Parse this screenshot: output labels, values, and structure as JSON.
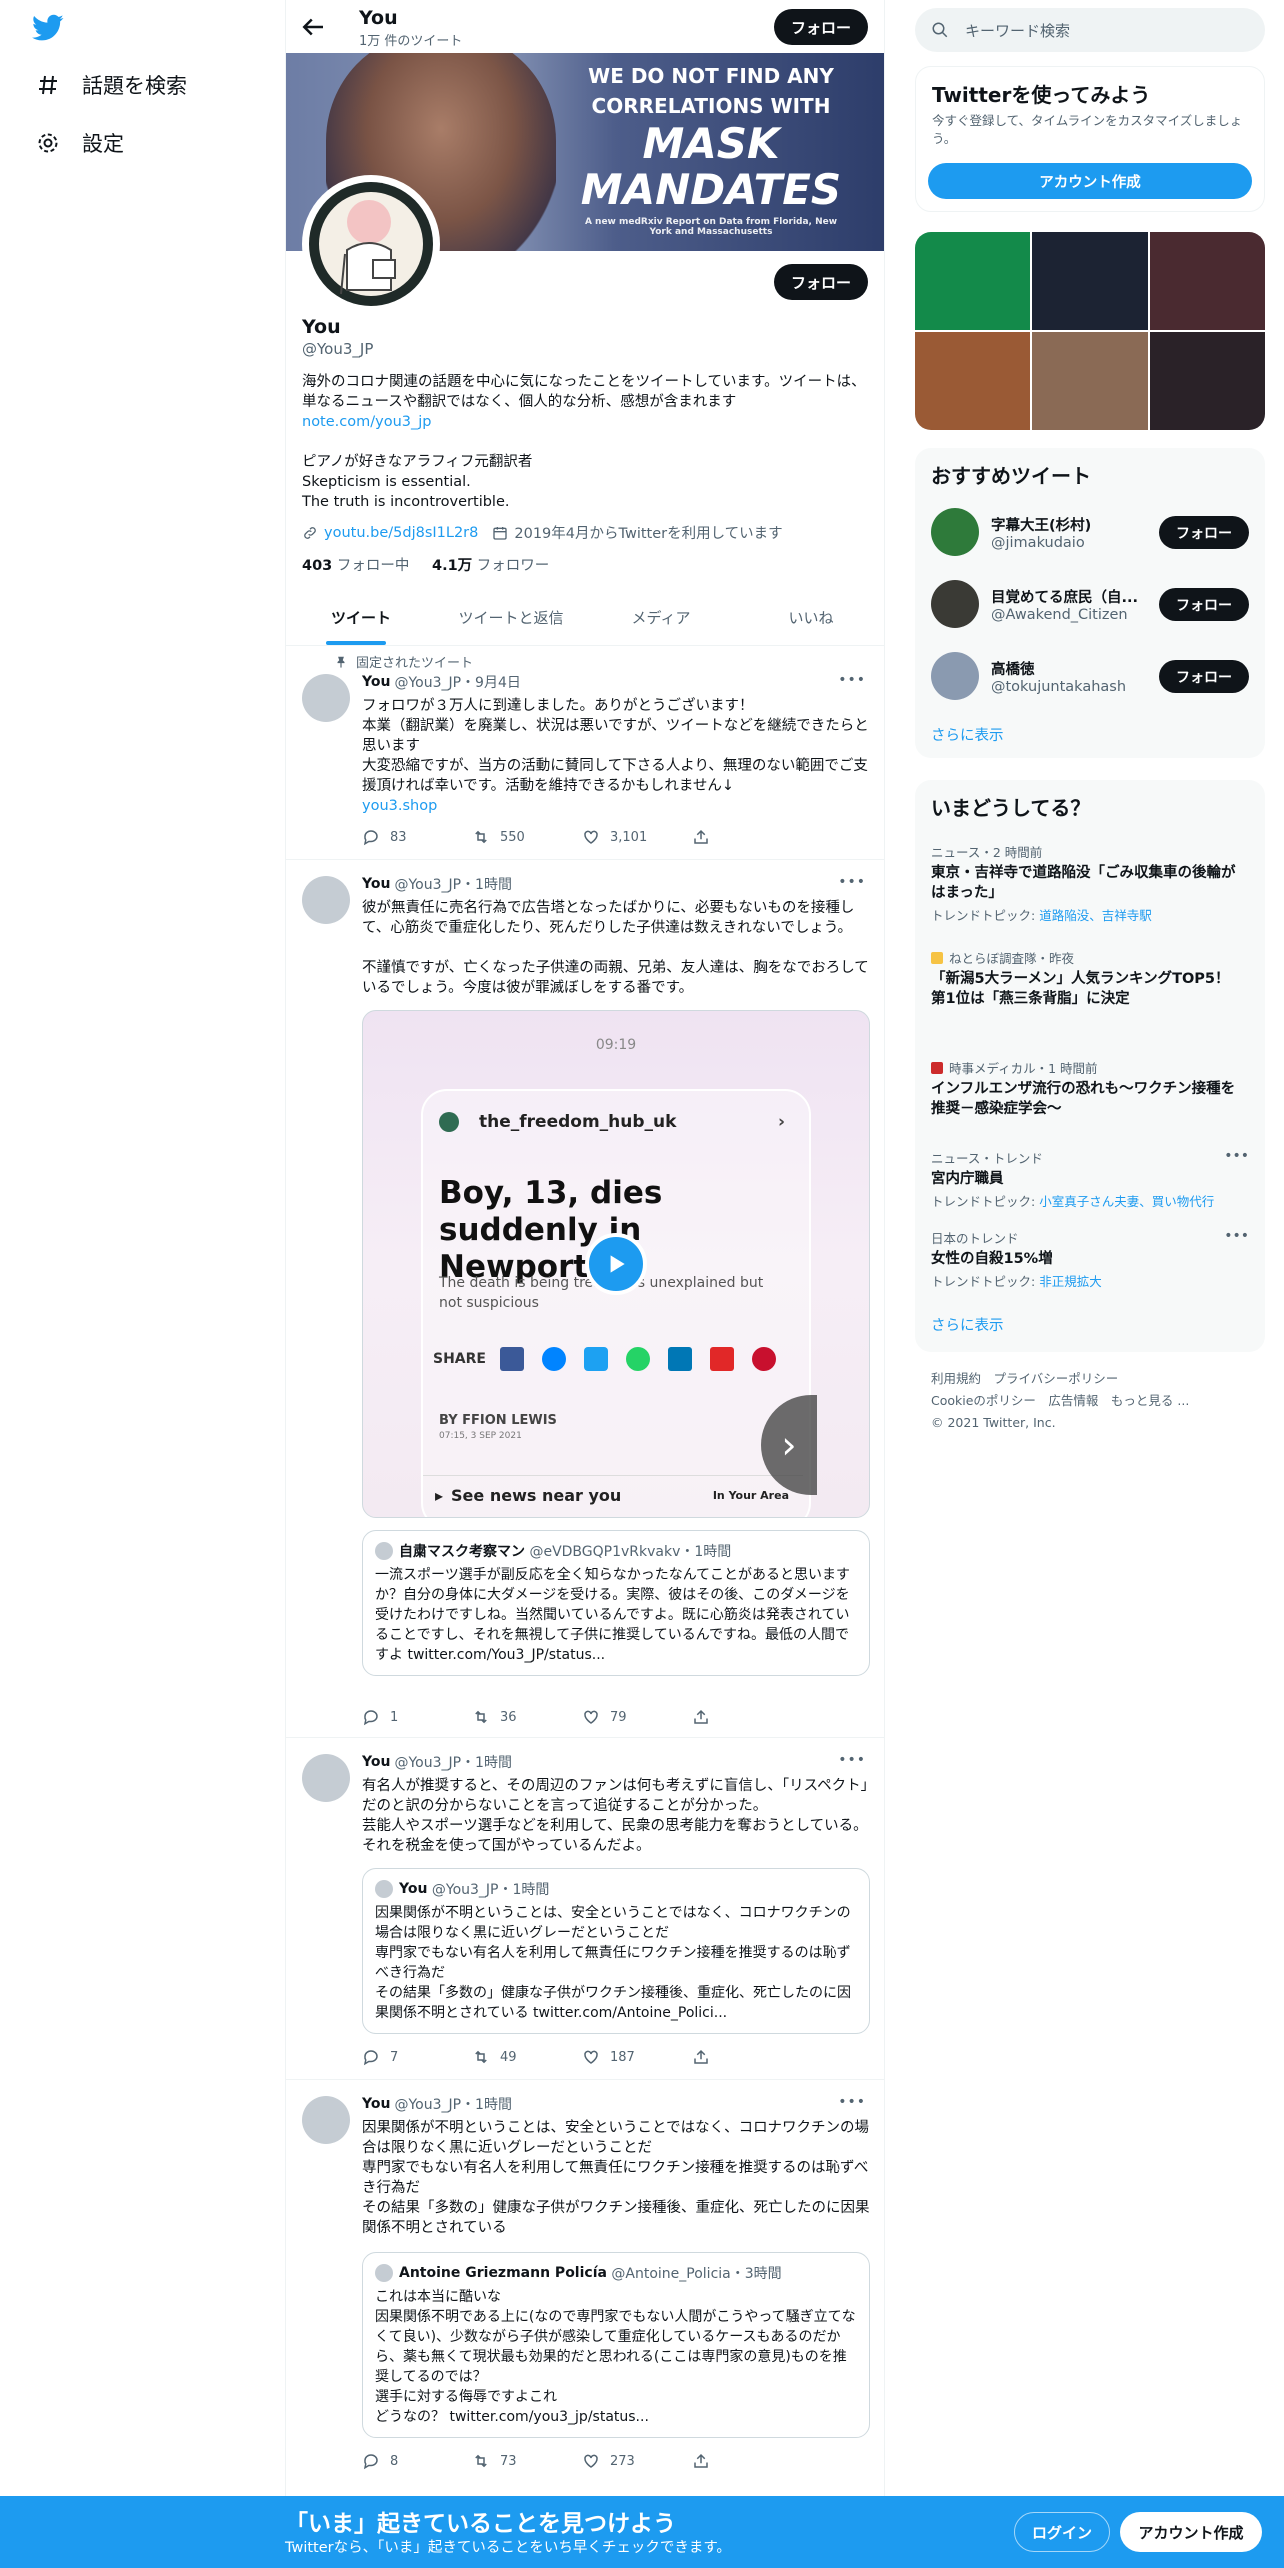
{
  "nav": {
    "explore": "話題を検索",
    "settings": "設定"
  },
  "header": {
    "name": "You",
    "tweet_count": "1万 件のツイート",
    "follow": "フォロー"
  },
  "banner": {
    "line1": "WE DO NOT FIND ANY",
    "line2": "CORRELATIONS WITH",
    "line3": "MASK",
    "line4": "MANDATES",
    "small": "A new medRxiv Report on Data from Florida, New York and Massachusetts"
  },
  "profile": {
    "name": "You",
    "handle": "@You3_JP",
    "follow": "フォロー",
    "bio1": "海外のコロナ関連の話題を中心に気になったことをツイートしています。ツイートは、単なるニュースや翻訳ではなく、個人的な分析、感想が含まれます",
    "bio_link": "note.com/you3_jp",
    "bio2": "ピアノが好きなアラフィフ元翻訳者\nSkepticism is essential.\nThe truth is incontrovertible.",
    "website": "youtu.be/5dj8sI1L2r8",
    "joined": "2019年4月からTwitterを利用しています",
    "following_count": "403",
    "following_label": "フォロー中",
    "followers_count": "4.1万",
    "followers_label": "フォロワー"
  },
  "tabs": [
    "ツイート",
    "ツイートと返信",
    "メディア",
    "いいね"
  ],
  "tweets": [
    {
      "pinned": "固定されたツイート",
      "name": "You",
      "meta": "@You3_JP・9月4日",
      "text": "フォロワが３万人に到達しました。ありがとうございます！\n本業（翻訳業）を廃業し、状況は悪いですが、ツイートなどを継続できたらと思います\n大変恐縮ですが、当方の活動に賛同して下さる人より、無理のない範囲でご支援頂ければ幸いです。活動を維持できるかもしれません↓",
      "link": "you3.shop",
      "replies": "83",
      "retweets": "550",
      "likes": "3,101"
    },
    {
      "name": "You",
      "meta": "@You3_JP・1時間",
      "text": "彼が無責任に売名行為で広告塔となったばかりに、必要もないものを接種して、心筋炎で重症化したり、死んだりした子供達は数えきれないでしょう。\n\n不謹慎ですが、亡くなった子供達の両親、兄弟、友人達は、胸をなでおろしているでしょう。今度は彼が罪滅ぼしをする番です。",
      "video": {
        "time": "09:19",
        "account": "the_freedom_hub_uk",
        "headline": "Boy, 13, dies suddenly in Newport",
        "sub": "The death is being treated as unexplained but not suspicious",
        "share": "SHARE",
        "byline": "BY FFION LEWIS",
        "date": "07:15, 3 SEP 2021",
        "news": "See news near you",
        "brand": "In Your Area"
      },
      "quote": {
        "name": "自粛マスク考察マン",
        "meta": "@eVDBGQP1vRkvakv・1時間",
        "text": "一流スポーツ選手が副反応を全く知らなかったなんてことがあると思いますか？自分の身体に大ダメージを受ける。実際、彼はその後、このダメージを受けたわけですしね。当然聞いているんですよ。既に心筋炎は発表されていることですし、それを無視して子供に推奨しているんですね。最低の人間ですよ twitter.com/You3_JP/status..."
      },
      "replies": "1",
      "retweets": "36",
      "likes": "79"
    },
    {
      "name": "You",
      "meta": "@You3_JP・1時間",
      "text": "有名人が推奨すると、その周辺のファンは何も考えずに盲信し、「リスペクト」だのと訳の分からないことを言って追従することが分かった。\n芸能人やスポーツ選手などを利用して、民衆の思考能力を奪おうとしている。それを税金を使って国がやっているんだよ。",
      "quote": {
        "name": "You",
        "meta": "@You3_JP・1時間",
        "text": "因果関係が不明ということは、安全ということではなく、コロナワクチンの場合は限りなく黒に近いグレーだということだ\n専門家でもない有名人を利用して無責任にワクチン接種を推奨するのは恥ずべき行為だ\nその結果「多数の」健康な子供がワクチン接種後、重症化、死亡したのに因果関係不明とされている twitter.com/Antoine_Polici..."
      },
      "replies": "7",
      "retweets": "49",
      "likes": "187"
    },
    {
      "name": "You",
      "meta": "@You3_JP・1時間",
      "text": "因果関係が不明ということは、安全ということではなく、コロナワクチンの場合は限りなく黒に近いグレーだということだ\n専門家でもない有名人を利用して無責任にワクチン接種を推奨するのは恥ずべき行為だ\nその結果「多数の」健康な子供がワクチン接種後、重症化、死亡したのに因果関係不明とされている",
      "quote": {
        "name": "Antoine Griezmann Policía",
        "meta": "@Antoine_Policia・3時間",
        "text": "これは本当に酷いな\n因果関係不明である上に(なので専門家でもない人間がこうやって騒ぎ立てなくて良い)、少数ながら子供が感染して重症化しているケースもあるのだから、薬も無くて現状最も効果的だと思われる(ここは専門家の意見)ものを推奨してるのでは？\n選手に対する侮辱ですよこれ\nどうなの？ twitter.com/you3_jp/status..."
      },
      "replies": "8",
      "retweets": "73",
      "likes": "273"
    }
  ],
  "right": {
    "search_placeholder": "キーワード検索",
    "signup_title": "Twitterを使ってみよう",
    "signup_desc": "今すぐ登録して、タイムラインをカスタマイズしましょう。",
    "signup_button": "アカウント作成",
    "photo_colors": [
      "#138a4a",
      "#1c2333",
      "#4a2a30",
      "#9a5a35",
      "#8a6a55",
      "#2a2228"
    ],
    "who_title": "おすすめツイート",
    "who": [
      {
        "name": "字幕大王(杉村)",
        "handle": "@jimakudaio",
        "follow": "フォロー",
        "color": "#2e7a3a"
      },
      {
        "name": "目覚めてる庶民（自...",
        "handle": "@Awakend_Citizen",
        "follow": "フォロー",
        "color": "#3a3a35"
      },
      {
        "name": "高橋徳",
        "handle": "@tokujuntakahash",
        "follow": "フォロー",
        "color": "#8a9ab0"
      }
    ],
    "show_more": "さらに表示",
    "trends_title": "いまどうしてる？",
    "trends": [
      {
        "meta": "ニュース・2 時間前",
        "title": "東京・吉祥寺で道路陥没「ごみ収集車の後輪がはまった」",
        "topic_label": "トレンドトピック:",
        "topic": "道路陥没、吉祥寺駅"
      },
      {
        "meta": "ねとらぼ調査隊・昨夜",
        "title": "「新潟5大ラーメン」人気ランキングTOP5！　第1位は「燕三条背脂」に決定"
      },
      {
        "meta": "時事メディカル・1 時間前",
        "title": "インフルエンザ流行の恐れも～ワクチン接種を推奨－感染症学会～"
      },
      {
        "meta": "ニュース・トレンド",
        "title": "宮内庁職員",
        "topic_label": "トレンドトピック:",
        "topic": "小室真子さん夫妻、買い物代行"
      },
      {
        "meta": "日本のトレンド",
        "title": "女性の自殺15%増",
        "topic_label": "トレンドトピック:",
        "topic": "非正規拡大"
      }
    ],
    "footer_line1": "利用規約　プライバシーポリシー",
    "footer_line2": "Cookieのポリシー　広告情報　もっと見る ...",
    "footer_line3": "© 2021 Twitter, Inc."
  },
  "bottom": {
    "title": "「いま」起きていることを見つけよう",
    "sub": "Twitterなら、「いま」起きていることをいち早くチェックできます。",
    "login": "ログイン",
    "signup": "アカウント作成"
  }
}
